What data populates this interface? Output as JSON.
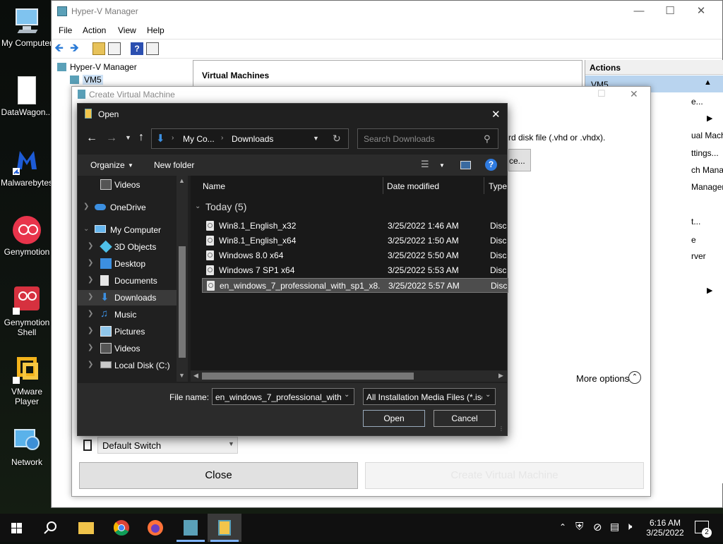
{
  "desktop": {
    "icons": [
      {
        "label": "My Computer"
      },
      {
        "label": "DataWagon..."
      },
      {
        "label": "Malwarebytes"
      },
      {
        "label": "Genymotion"
      },
      {
        "label": "Genymotion Shell"
      },
      {
        "label": "VMware Player"
      },
      {
        "label": "Network"
      }
    ]
  },
  "hyperv": {
    "title": "Hyper-V Manager",
    "menu": [
      "File",
      "Action",
      "View",
      "Help"
    ],
    "tree": {
      "root": "Hyper-V Manager",
      "child": "VM5"
    },
    "vm_pane_title": "Virtual Machines",
    "actions": {
      "header": "Actions",
      "vm": "VM5",
      "items": [
        "e...",
        "ual Machin...",
        "ttings...",
        "ch Manage...",
        "Manager...",
        "t...",
        "e",
        "rver"
      ]
    }
  },
  "wizard": {
    "title": "Create Virtual Machine",
    "hint_text": "rd disk file (.vhd or .vhdx).",
    "browse_label": "ce...",
    "more_options": "More options",
    "switch_value": "Default Switch",
    "close_label": "Close",
    "create_label": "Create Virtual Machine"
  },
  "open_dialog": {
    "title": "Open",
    "breadcrumb": [
      "My Co...",
      "Downloads"
    ],
    "search_placeholder": "Search Downloads",
    "organize": "Organize",
    "new_folder": "New folder",
    "columns": {
      "name": "Name",
      "date": "Date modified",
      "type": "Type"
    },
    "group": "Today (5)",
    "nav": [
      {
        "label": "Videos",
        "indent": 1
      },
      {
        "label": "OneDrive",
        "indent": 0
      },
      {
        "label": "My Computer",
        "indent": 0
      },
      {
        "label": "3D Objects",
        "indent": 1
      },
      {
        "label": "Desktop",
        "indent": 1
      },
      {
        "label": "Documents",
        "indent": 1
      },
      {
        "label": "Downloads",
        "indent": 1
      },
      {
        "label": "Music",
        "indent": 1
      },
      {
        "label": "Pictures",
        "indent": 1
      },
      {
        "label": "Videos",
        "indent": 1
      },
      {
        "label": "Local Disk (C:)",
        "indent": 1
      }
    ],
    "files": [
      {
        "name": "Win8.1_English_x32",
        "date": "3/25/2022 1:46 AM",
        "type": "Disc I"
      },
      {
        "name": "Win8.1_English_x64",
        "date": "3/25/2022 1:50 AM",
        "type": "Disc I"
      },
      {
        "name": "Windows 8.0 x64",
        "date": "3/25/2022 5:50 AM",
        "type": "Disc I"
      },
      {
        "name": "Windows 7 SP1 x64",
        "date": "3/25/2022 5:53 AM",
        "type": "Disc I"
      },
      {
        "name": "en_windows_7_professional_with_sp1_x8...",
        "date": "3/25/2022 5:57 AM",
        "type": "Disc I"
      }
    ],
    "file_name_label": "File name:",
    "file_name_value": "en_windows_7_professional_with_",
    "file_type_value": "All Installation Media Files (*.iso",
    "open_label": "Open",
    "cancel_label": "Cancel"
  },
  "taskbar": {
    "time": "6:16 AM",
    "date": "3/25/2022",
    "notification_count": "2"
  }
}
